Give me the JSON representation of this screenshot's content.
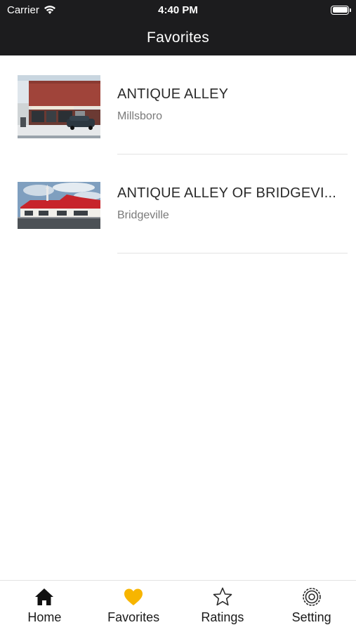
{
  "status_bar": {
    "carrier": "Carrier",
    "time": "4:40 PM"
  },
  "nav": {
    "title": "Favorites"
  },
  "favorites": [
    {
      "name": "ANTIQUE ALLEY",
      "location": "Millsboro"
    },
    {
      "name": "ANTIQUE ALLEY OF BRIDGEVI...",
      "location": "Bridgeville"
    }
  ],
  "tab_bar": {
    "active": "Favorites",
    "active_color": "#f7b500",
    "tabs": [
      {
        "label": "Home",
        "icon": "home-icon"
      },
      {
        "label": "Favorites",
        "icon": "heart-icon"
      },
      {
        "label": "Ratings",
        "icon": "star-icon"
      },
      {
        "label": "Setting",
        "icon": "gear-icon"
      }
    ]
  }
}
